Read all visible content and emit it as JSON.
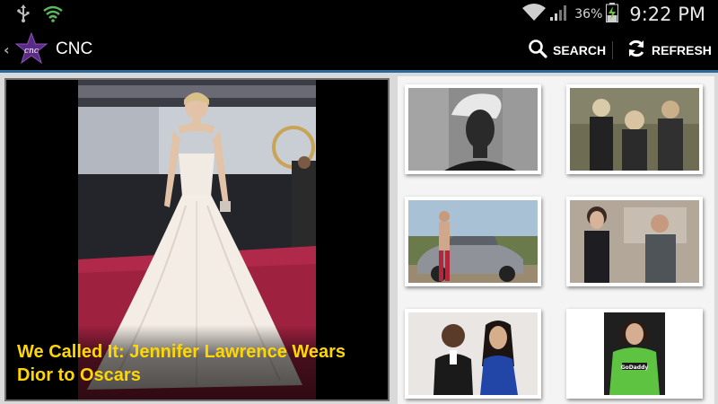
{
  "status_bar": {
    "icons": [
      "usb-icon",
      "wifi-sync-icon",
      "wifi-icon",
      "signal-icon",
      "battery-charging-icon"
    ],
    "battery_percent": "36%",
    "time": "9:22 PM"
  },
  "action_bar": {
    "title": "CNC",
    "logo_text": "cnc",
    "search_label": "SEARCH",
    "refresh_label": "REFRESH"
  },
  "featured": {
    "caption": "We Called It: Jennifer Lawrence Wears Dior to Oscars"
  },
  "colors": {
    "caption": "#ffd700",
    "actionbar_underline": "#2a6a9a",
    "logo_star": "#5b2a86"
  },
  "thumbnails": [
    {
      "subject": "platinum-hair-portrait"
    },
    {
      "subject": "three-women-group"
    },
    {
      "subject": "woman-with-sports-car"
    },
    {
      "subject": "couple-walking"
    },
    {
      "subject": "red-carpet-couple"
    },
    {
      "subject": "racing-driver"
    }
  ]
}
